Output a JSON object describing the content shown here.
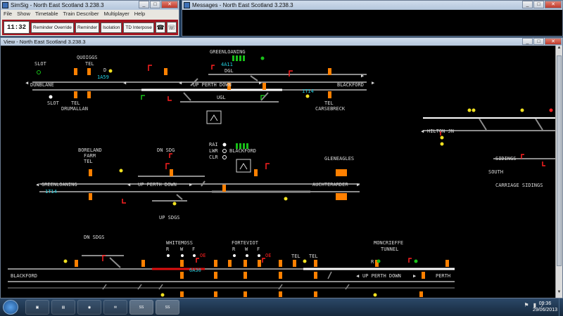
{
  "main_window": {
    "title": "SimSig - North East Scotland 3.238.3",
    "menu": [
      "File",
      "Show",
      "Timetable",
      "Train Describer",
      "Multiplayer",
      "Help"
    ],
    "clock": "11:32",
    "buttons": [
      "Reminder Override",
      "Reminder",
      "Isolation",
      "TD Interpose"
    ]
  },
  "messages_window": {
    "title": "Messages - North East Scotland 3.238.3"
  },
  "view_window": {
    "title": "View - North East Scotland 3.238.3"
  },
  "diagram": {
    "labels": {
      "greenloaning_top": "GREENLOANING",
      "quoiggs": "QUOIGGS",
      "tel_quoiggs": "TEL",
      "slot_top": "SLOT",
      "berth_4a11": "4A11",
      "dgl": "DGL",
      "berth_1a59": "1A59",
      "dunblane": "DUNBLANE",
      "up_perth_down_1": "UP PERTH DOWN",
      "blackford_1": "BLACKFORD",
      "berth_1t14_a": "1T14",
      "ugl": "UGL",
      "slot_bottom": "SLOT",
      "tel_drumallan": "TEL",
      "drumallan": "DRUMALLAN",
      "tel_carsebreck": "TEL",
      "carsebreck": "CARSEBRECK",
      "hilton_jn": "HILTON JN",
      "sidings": "SIDINGS",
      "south": "SOUTH",
      "carriage_sidings": "CARRIAGE SIDINGS",
      "rai": "RAI",
      "lwr": "LWR",
      "clr": "CLR",
      "blackford_2": "BLACKFORD",
      "boreland": "BORELAND",
      "farm": "FARM",
      "tel_boreland": "TEL",
      "dn_sdg": "DN SDG",
      "gleneagles": "GLENEAGLES",
      "greenloaning_2": "GREENLOANING",
      "up_perth_down_2": "UP PERTH DOWN",
      "auchterarder": "AUCHTERARDER",
      "berth_1t14_b": "1T14",
      "up_sdgs": "UP SDGS",
      "dn_sdgs": "DN SDGS",
      "whitemoss": "WHITEMOSS",
      "forteviot": "FORTEVIOT",
      "moncrieffe": "MONCRIEFFE",
      "tunnel": "TUNNEL",
      "tel_f1": "TEL",
      "tel_f2": "TEL",
      "berth_6a30": "6A30",
      "blackford_3": "BLACKFORD",
      "up_perth_down_3": "UP PERTH DOWN",
      "perth": "PERTH",
      "rwf_r1": "R",
      "rwf_w1": "W",
      "rwf_f1": "F",
      "rwf_r2": "R",
      "rwf_w2": "W",
      "rwf_f2": "F",
      "oe_1": "OE",
      "oe_2": "OE",
      "d_marker": "D",
      "r_marker": "R"
    },
    "colors": {
      "track": "#8c8c8c",
      "track_white": "#ffffff",
      "route_red": "#e01010",
      "berth_cyan": "#22d0e0",
      "signal_orange": "#ff8000",
      "label_white": "#d8d8d8",
      "green": "#18c018",
      "yellow": "#f0e020",
      "red": "#ff2020"
    }
  },
  "taskbar": {
    "time": "09:36",
    "date": "29/06/2013",
    "apps": [
      "explorer",
      "files",
      "chrome",
      "outlook",
      "simsig",
      "simsig"
    ]
  }
}
